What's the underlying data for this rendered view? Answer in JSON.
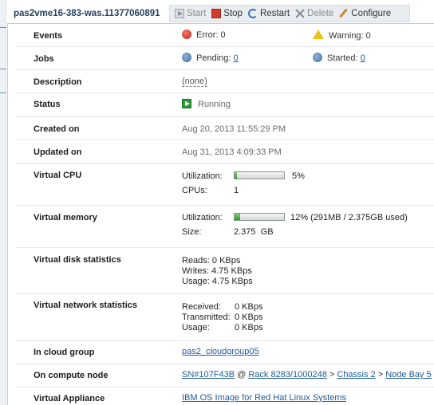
{
  "vm_name": "pas2vme16-383-was.11377060891",
  "toolbar": {
    "start": "Start",
    "stop": "Stop",
    "restart": "Restart",
    "delete": "Delete",
    "configure": "Configure"
  },
  "rows": {
    "events": {
      "label": "Events",
      "error_text": "Error: 0",
      "warning_text": "Warning: 0"
    },
    "jobs": {
      "label": "Jobs",
      "pending_label": "Pending:",
      "pending_value": "0",
      "started_label": "Started:",
      "started_value": "0"
    },
    "description": {
      "label": "Description",
      "value": "(none)"
    },
    "status": {
      "label": "Status",
      "value": "Running"
    },
    "created_on": {
      "label": "Created on",
      "value": "Aug 20, 2013 11:55:29 PM"
    },
    "updated_on": {
      "label": "Updated on",
      "value": "Aug 31, 2013 4:09:33 PM"
    },
    "virtual_cpu": {
      "label": "Virtual CPU",
      "utilization_label": "Utilization:",
      "utilization_percent": 5,
      "utilization_text": "5%",
      "cpus_label": "CPUs:",
      "cpus_value": "1"
    },
    "virtual_memory": {
      "label": "Virtual memory",
      "utilization_label": "Utilization:",
      "utilization_percent": 12,
      "utilization_text": "12% (291MB / 2.375GB used)",
      "size_label": "Size:",
      "size_value": "2.375  GB"
    },
    "disk": {
      "label": "Virtual disk statistics",
      "reads": "Reads: 0 KBps",
      "writes": "Writes: 4.75 KBps",
      "usage": "Usage: 4.75 KBps"
    },
    "network": {
      "label": "Virtual network statistics",
      "received_label": "Received:",
      "received_value": "0 KBps",
      "transmitted_label": "Transmitted:",
      "transmitted_value": "0 KBps",
      "usage_label": "Usage:",
      "usage_value": "0 KBps"
    },
    "cloud_group": {
      "label": "In cloud group",
      "value": "pas2_cloudgroup05"
    },
    "compute_node": {
      "label": "On compute node",
      "node": "SN#107F43B",
      "at": "@",
      "rack": "Rack 8283/1000248",
      "chassis": "Chassis 2",
      "bay": "Node Bay 5",
      "sep": ">"
    },
    "appliance": {
      "label": "Virtual Appliance",
      "value": "IBM OS Image for Red Hat Linux Systems"
    }
  },
  "colors": {
    "link": "#1f5a96",
    "error": "#c41f12",
    "warning": "#e8c21b",
    "running": "#2e9a3a",
    "bar_fill": "#2b9a24"
  }
}
